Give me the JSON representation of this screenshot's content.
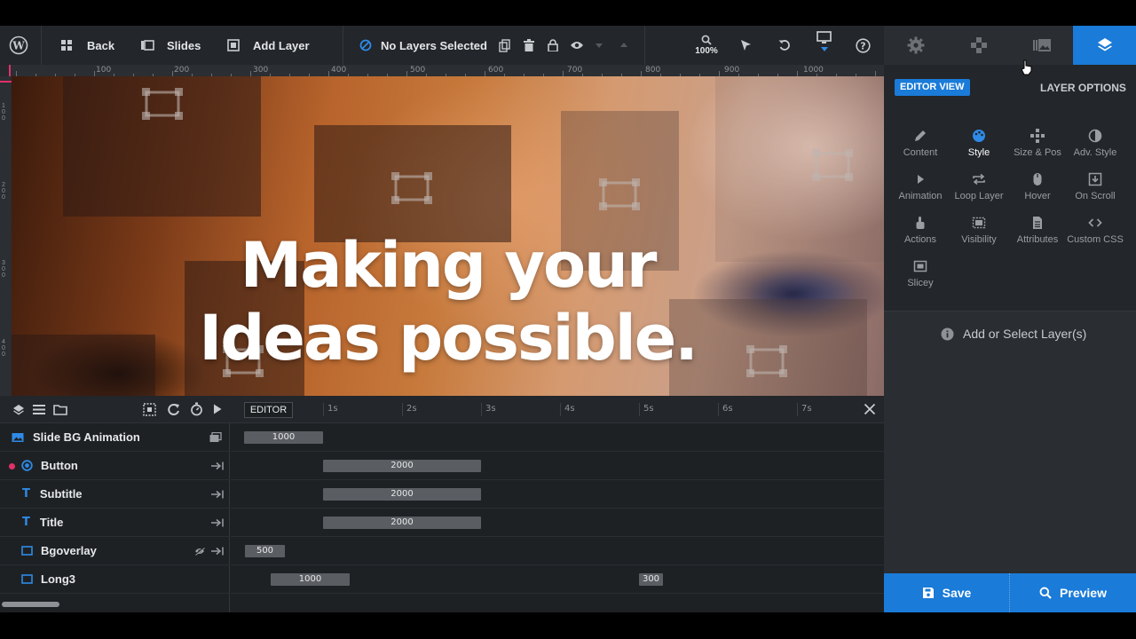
{
  "toolbar": {
    "back_label": "Back",
    "slides_label": "Slides",
    "add_layer_label": "Add Layer",
    "selection_status": "No Layers Selected",
    "zoom": "100%"
  },
  "right_tabs": [
    {
      "icon": "gear-icon"
    },
    {
      "icon": "gamepad-icon"
    },
    {
      "icon": "gallery-icon"
    },
    {
      "icon": "layers-icon",
      "active": true
    }
  ],
  "ruler": {
    "labels": [
      "100",
      "200",
      "300",
      "400",
      "500",
      "600",
      "700",
      "800",
      "900",
      "1000"
    ]
  },
  "canvas": {
    "headline_line1": "Making your",
    "headline_line2": "Ideas possible."
  },
  "timeline": {
    "mode_label": "EDITOR",
    "seconds": [
      "1s",
      "2s",
      "3s",
      "4s",
      "5s",
      "6s",
      "7s"
    ],
    "layers": [
      {
        "name": "Slide BG Animation",
        "type": "slide",
        "bars": [
          {
            "label": "1000"
          }
        ]
      },
      {
        "name": "Button",
        "type": "button",
        "bars": [
          {
            "label": "2000"
          }
        ]
      },
      {
        "name": "Subtitle",
        "type": "text",
        "bars": [
          {
            "label": "2000"
          }
        ]
      },
      {
        "name": "Title",
        "type": "text",
        "bars": [
          {
            "label": "2000"
          }
        ]
      },
      {
        "name": "Bgoverlay",
        "type": "shape",
        "hidden": true,
        "bars": [
          {
            "label": "500"
          }
        ]
      },
      {
        "name": "Long3",
        "type": "shape",
        "bars": [
          {
            "label": "1000"
          },
          {
            "label": "300"
          }
        ]
      }
    ]
  },
  "panel": {
    "editor_view_label": "EDITOR VIEW",
    "layer_options_label": "LAYER OPTIONS",
    "options": [
      {
        "label": "Content",
        "icon": "pencil-icon"
      },
      {
        "label": "Style",
        "icon": "palette-icon",
        "active": true
      },
      {
        "label": "Size & Pos",
        "icon": "move-icon"
      },
      {
        "label": "Adv. Style",
        "icon": "contrast-icon"
      },
      {
        "label": "Animation",
        "icon": "play-icon"
      },
      {
        "label": "Loop Layer",
        "icon": "loop-icon"
      },
      {
        "label": "Hover",
        "icon": "mouse-icon"
      },
      {
        "label": "On Scroll",
        "icon": "download-icon"
      },
      {
        "label": "Actions",
        "icon": "pointer-icon"
      },
      {
        "label": "Visibility",
        "icon": "visibility-icon"
      },
      {
        "label": "Attributes",
        "icon": "document-icon"
      },
      {
        "label": "Custom CSS",
        "icon": "code-icon"
      },
      {
        "label": "Slicey",
        "icon": "slicey-icon"
      }
    ],
    "empty_message": "Add or Select Layer(s)"
  },
  "footer": {
    "save_label": "Save",
    "preview_label": "Preview"
  },
  "colors": {
    "accent": "#1a7bd8",
    "toolbar_bg": "#23262a",
    "timeline_bar": "#5a5e63",
    "layer_icon_blue": "#2e8ae6",
    "button_dot": "#e0306a"
  }
}
